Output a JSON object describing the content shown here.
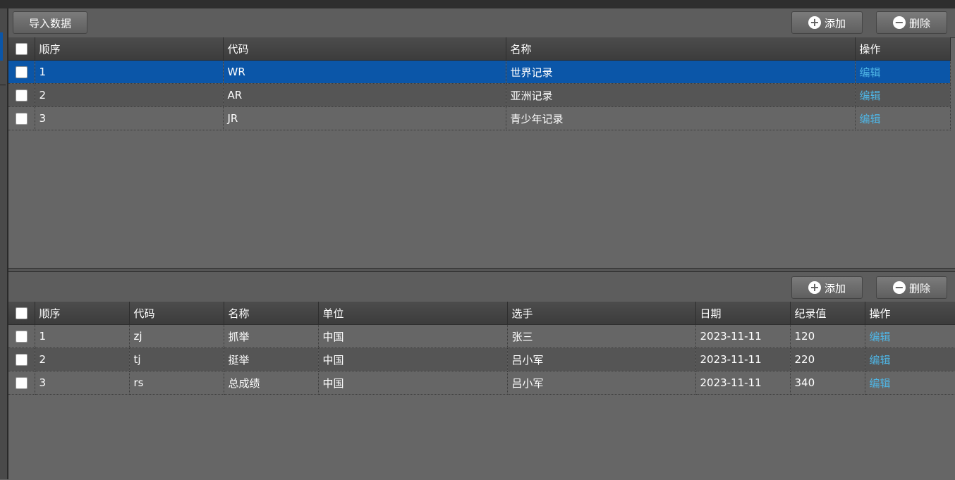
{
  "top_panel": {
    "import_button": "导入数据",
    "add_button": "添加",
    "delete_button": "删除",
    "columns": [
      "顺序",
      "代码",
      "名称",
      "操作"
    ],
    "rows": [
      {
        "order": "1",
        "code": "WR",
        "name": "世界记录",
        "action": "编辑"
      },
      {
        "order": "2",
        "code": "AR",
        "name": "亚洲记录",
        "action": "编辑"
      },
      {
        "order": "3",
        "code": "JR",
        "name": "青少年记录",
        "action": "编辑"
      }
    ]
  },
  "bottom_panel": {
    "add_button": "添加",
    "delete_button": "删除",
    "columns": [
      "顺序",
      "代码",
      "名称",
      "单位",
      "选手",
      "日期",
      "纪录值",
      "操作"
    ],
    "rows": [
      {
        "order": "1",
        "code": "zj",
        "name": "抓举",
        "unit": "中国",
        "athlete": "张三",
        "date": "2023-11-11",
        "value": "120",
        "action": "编辑"
      },
      {
        "order": "2",
        "code": "tj",
        "name": "挺举",
        "unit": "中国",
        "athlete": "吕小军",
        "date": "2023-11-11",
        "value": "220",
        "action": "编辑"
      },
      {
        "order": "3",
        "code": "rs",
        "name": "总成绩",
        "unit": "中国",
        "athlete": "吕小军",
        "date": "2023-11-11",
        "value": "340",
        "action": "编辑"
      }
    ]
  },
  "icons": {
    "add": "plus-circle-icon",
    "delete": "minus-circle-icon"
  },
  "colors": {
    "selected_row": "#0b56a8",
    "link": "#4fb6e6",
    "background": "#666666"
  }
}
